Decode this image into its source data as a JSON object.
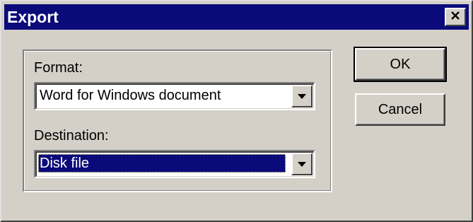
{
  "window": {
    "title": "Export"
  },
  "icons": {
    "close": "close-icon",
    "format_dropdown": "chevron-down-icon",
    "destination_dropdown": "chevron-down-icon"
  },
  "colors": {
    "titlebar": "#0a0a7a",
    "face": "#d4d0c8",
    "selection": "#0a0a7a"
  },
  "form": {
    "format_label": "Format:",
    "format_value": "Word for Windows document",
    "destination_label": "Destination:",
    "destination_value": "Disk file"
  },
  "buttons": {
    "ok_label": "OK",
    "cancel_label": "Cancel"
  }
}
